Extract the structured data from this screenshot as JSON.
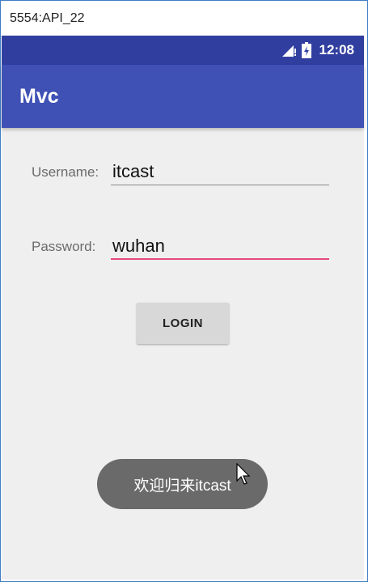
{
  "window": {
    "title": "5554:API_22"
  },
  "status_bar": {
    "time": "12:08"
  },
  "app_bar": {
    "title": "Mvc"
  },
  "form": {
    "username_label": "Username:",
    "username_value": "itcast",
    "password_label": "Password:",
    "password_value": "wuhan",
    "login_label": "LOGIN"
  },
  "toast": {
    "message": "欢迎归来itcast"
  },
  "colors": {
    "status_bar": "#303f9f",
    "app_bar": "#3f51b5",
    "accent": "#e64a7c",
    "background": "#efefef"
  }
}
